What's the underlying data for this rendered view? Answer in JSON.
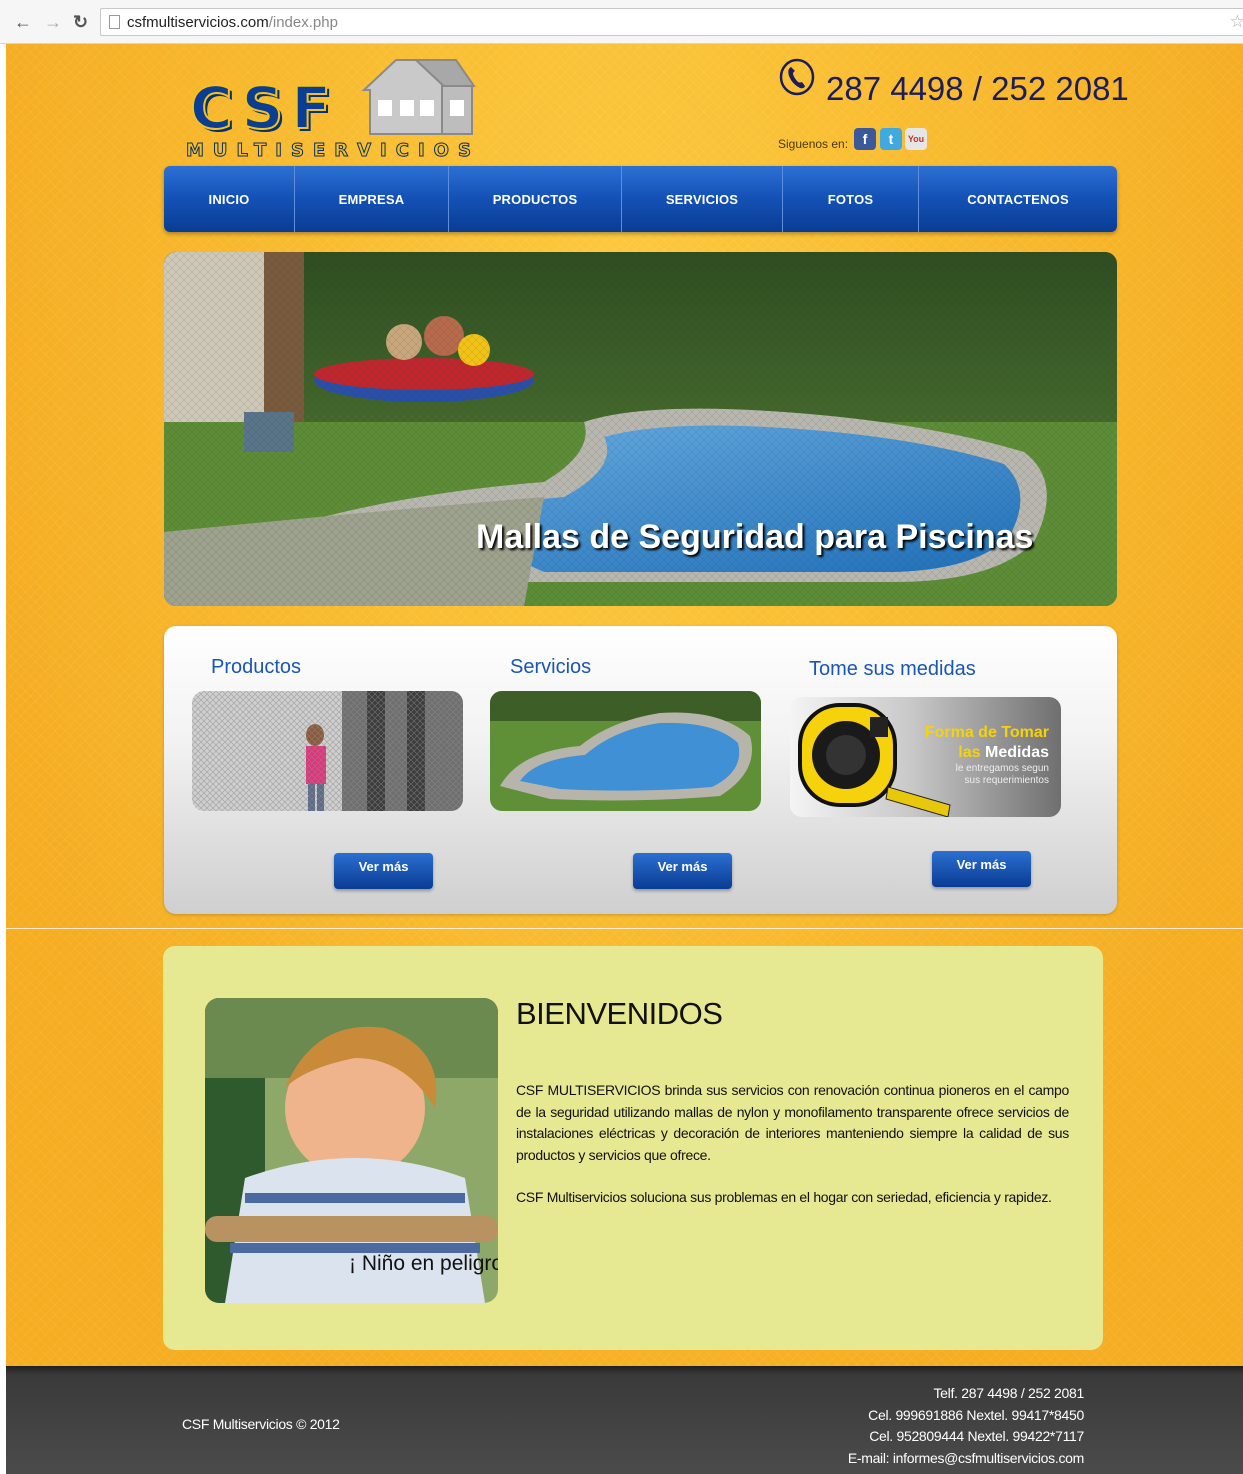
{
  "browser": {
    "url_domain": "csfmultiservicios.com",
    "url_path": "/index.php"
  },
  "header": {
    "logo_main": "CSF",
    "logo_sub": "MULTISERVICIOS",
    "phone": "287 4498 / 252 2081",
    "social_label": "Siguenos en:",
    "social_fb": "f",
    "social_tw": "t",
    "social_yt": "You"
  },
  "nav": {
    "items": [
      {
        "label": "INICIO"
      },
      {
        "label": "EMPRESA"
      },
      {
        "label": "PRODUCTOS"
      },
      {
        "label": "SERVICIOS"
      },
      {
        "label": "FOTOS"
      },
      {
        "label": "CONTACTENOS"
      }
    ]
  },
  "hero": {
    "caption": "Mallas de Seguridad para Piscinas"
  },
  "features": [
    {
      "title": "Productos",
      "button": "Ver más"
    },
    {
      "title": "Servicios",
      "button": "Ver más"
    },
    {
      "title": "Tome sus medidas",
      "button": "Ver más",
      "promo_line1": "Forma de Tomar",
      "promo_line2a": "las ",
      "promo_line2b": "Medidas",
      "promo_sub1": "le entregamos segun",
      "promo_sub2": "sus requerimientos"
    }
  ],
  "welcome": {
    "title": "BIENVENIDOS",
    "image_caption": "¡ Niño en peligro!",
    "paragraph1": "CSF MULTISERVICIOS brinda sus servicios con renovación continua pioneros en el campo de la seguridad utilizando mallas de nylon y monofilamento transparente ofrece servicios de instalaciones eléctricas y decoración de interiores manteniendo siempre la calidad de sus productos y servicios que ofrece.",
    "paragraph2": "CSF Multiservicios soluciona sus problemas en el hogar con seriedad, eficiencia y rapidez."
  },
  "footer": {
    "copyright": "CSF Multiservicios © 2012",
    "contact": [
      "Telf. 287 4498 / 252 2081",
      "Cel. 999691886 Nextel. 99417*8450",
      "Cel. 952809444 Nextel. 99422*7117",
      "E-mail: informes@csfmultiservicios.com"
    ]
  }
}
